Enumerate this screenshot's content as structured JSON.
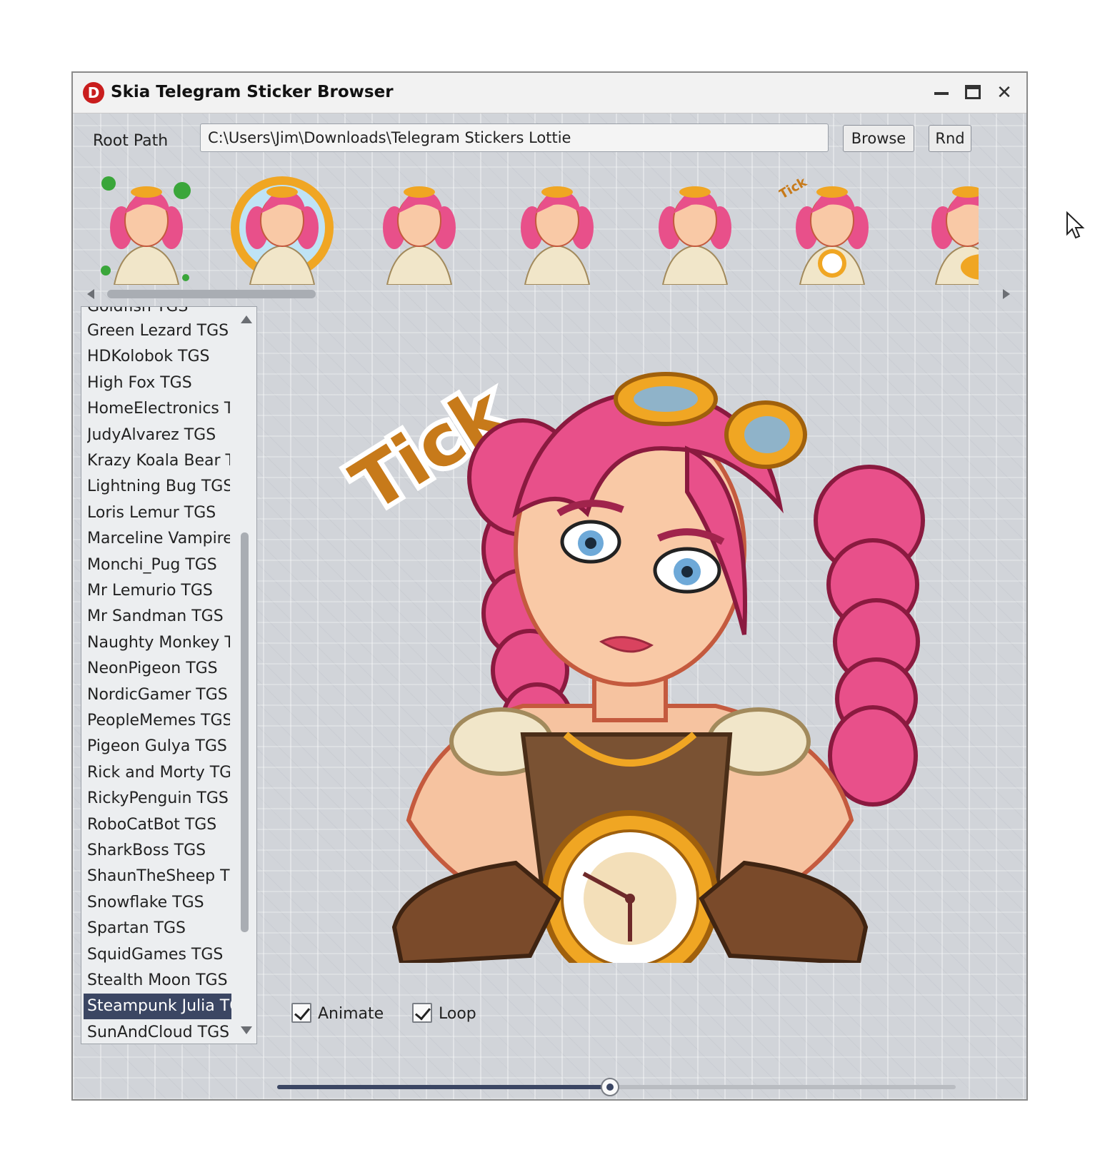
{
  "window": {
    "title": "Skia Telegram Sticker Browser",
    "logo_letter": "D"
  },
  "toolbar": {
    "root_path_label": "Root Path",
    "root_path_value": "C:\\Users\\Jim\\Downloads\\Telegram Stickers Lottie",
    "browse_label": "Browse",
    "rnd_label": "Rnd"
  },
  "sticker_list": {
    "partial_top": "Goldfish TGS",
    "items": [
      "Green Lezard TGS",
      "HDKolobok TGS",
      "High Fox TGS",
      "HomeElectronics TGS",
      "JudyAlvarez TGS",
      "Krazy Koala Bear TGS",
      "Lightning Bug TGS",
      "Loris Lemur TGS",
      "Marceline Vampire TGS",
      "Monchi_Pug TGS",
      "Mr Lemurio TGS",
      "Mr Sandman TGS",
      "Naughty Monkey TGS",
      "NeonPigeon TGS",
      "NordicGamer TGS",
      "PeopleMemes TGS",
      "Pigeon Gulya TGS",
      "Rick and Morty TGS",
      "RickyPenguin TGS",
      "RoboCatBot TGS",
      "SharkBoss TGS",
      "ShaunTheSheep TGS",
      "Snowflake TGS",
      "Spartan TGS",
      "SquidGames TGS",
      "Stealth Moon TGS",
      "Steampunk Julia TGS",
      "SunAndCloud TGS"
    ],
    "selected": "Steampunk Julia TGS"
  },
  "preview": {
    "caption": "Tick"
  },
  "controls": {
    "animate_label": "Animate",
    "animate_checked": true,
    "loop_label": "Loop",
    "loop_checked": true,
    "progress": 0.49
  },
  "thumb_caption": "Tick",
  "colors": {
    "accent": "#3b4663",
    "hair": "#e8508a",
    "gold": "#f0a623",
    "tick_text": "#c77a1a"
  }
}
